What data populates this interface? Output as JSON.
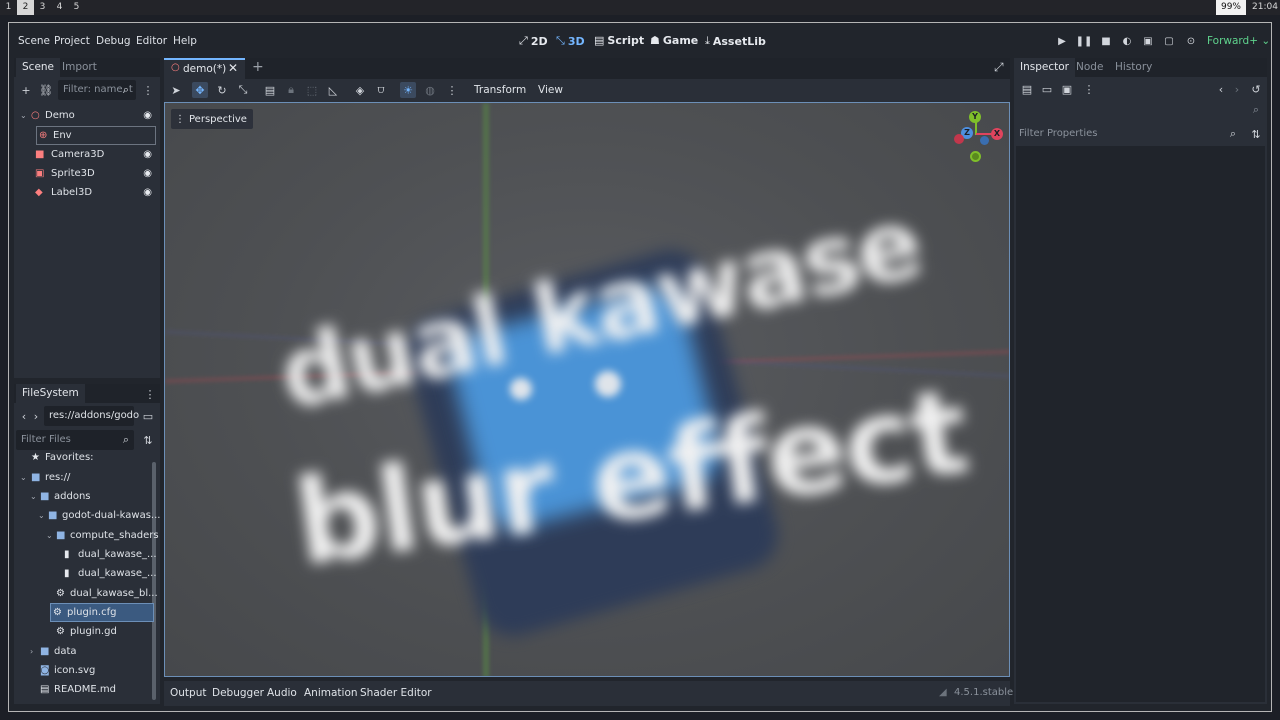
{
  "wm": {
    "workspaces": [
      "1",
      "2",
      "3",
      "4",
      "5"
    ],
    "active_workspace": "2",
    "battery": "99%",
    "clock": "21:04"
  },
  "menu": {
    "items": [
      "Scene",
      "Project",
      "Debug",
      "Editor",
      "Help"
    ],
    "workspaces": [
      {
        "label": "2D",
        "icon": "2d-icon",
        "active": false
      },
      {
        "label": "3D",
        "icon": "3d-icon",
        "active": true
      },
      {
        "label": "Script",
        "icon": "script-icon",
        "active": false
      },
      {
        "label": "Game",
        "icon": "game-icon",
        "active": false
      },
      {
        "label": "AssetLib",
        "icon": "assetlib-icon",
        "active": false
      }
    ],
    "renderer": "Forward+"
  },
  "scene_dock": {
    "tabs": [
      "Scene",
      "Import"
    ],
    "filter_placeholder": "Filter: name, t",
    "nodes": [
      {
        "name": "Demo",
        "icon": "node3d-icon",
        "visible": true
      },
      {
        "name": "Env",
        "icon": "world-environment-icon",
        "visible": null
      },
      {
        "name": "Camera3D",
        "icon": "camera3d-icon",
        "visible": true
      },
      {
        "name": "Sprite3D",
        "icon": "sprite3d-icon",
        "visible": true
      },
      {
        "name": "Label3D",
        "icon": "label3d-icon",
        "visible": true
      }
    ]
  },
  "filesystem": {
    "title": "FileSystem",
    "path": "res://addons/godo",
    "filter_placeholder": "Filter Files",
    "items": [
      {
        "label": "Favorites:",
        "icon": "star-icon"
      },
      {
        "label": "res://",
        "icon": "folder-icon"
      },
      {
        "label": "addons",
        "icon": "folder-icon"
      },
      {
        "label": "godot-dual-kawas...",
        "icon": "folder-icon"
      },
      {
        "label": "compute_shaders",
        "icon": "folder-icon"
      },
      {
        "label": "dual_kawase_...",
        "icon": "file-icon"
      },
      {
        "label": "dual_kawase_...",
        "icon": "file-icon"
      },
      {
        "label": "dual_kawase_bl...",
        "icon": "gear-icon"
      },
      {
        "label": "plugin.cfg",
        "icon": "config-file-icon"
      },
      {
        "label": "plugin.gd",
        "icon": "gear-icon"
      },
      {
        "label": "data",
        "icon": "folder-icon"
      },
      {
        "label": "icon.svg",
        "icon": "image-icon"
      },
      {
        "label": "README.md",
        "icon": "text-file-icon"
      }
    ]
  },
  "editor": {
    "scene_tab": "demo(*)",
    "toolbar_menus": [
      "Transform",
      "View"
    ],
    "viewport_label": "Perspective",
    "gizmo_labels": {
      "x": "X",
      "y": "Y",
      "z": "Z"
    }
  },
  "viewport_text": {
    "line1": "dual kawase",
    "line2": "blur effect"
  },
  "inspector": {
    "tabs": [
      "Inspector",
      "Node",
      "History"
    ],
    "filter_placeholder": "Filter Properties"
  },
  "bottom": {
    "tabs": [
      "Output",
      "Debugger",
      "Audio",
      "Animation",
      "Shader Editor"
    ],
    "version": "4.5.1.stable"
  },
  "colors": {
    "accent": "#74b6ff",
    "selection": "#3b5a80",
    "renderer": "#5fd38d",
    "node_red": "#fc7f7f",
    "axis_x": "#e0445d",
    "axis_y": "#7fbf2a",
    "axis_z": "#4d8fe0"
  }
}
